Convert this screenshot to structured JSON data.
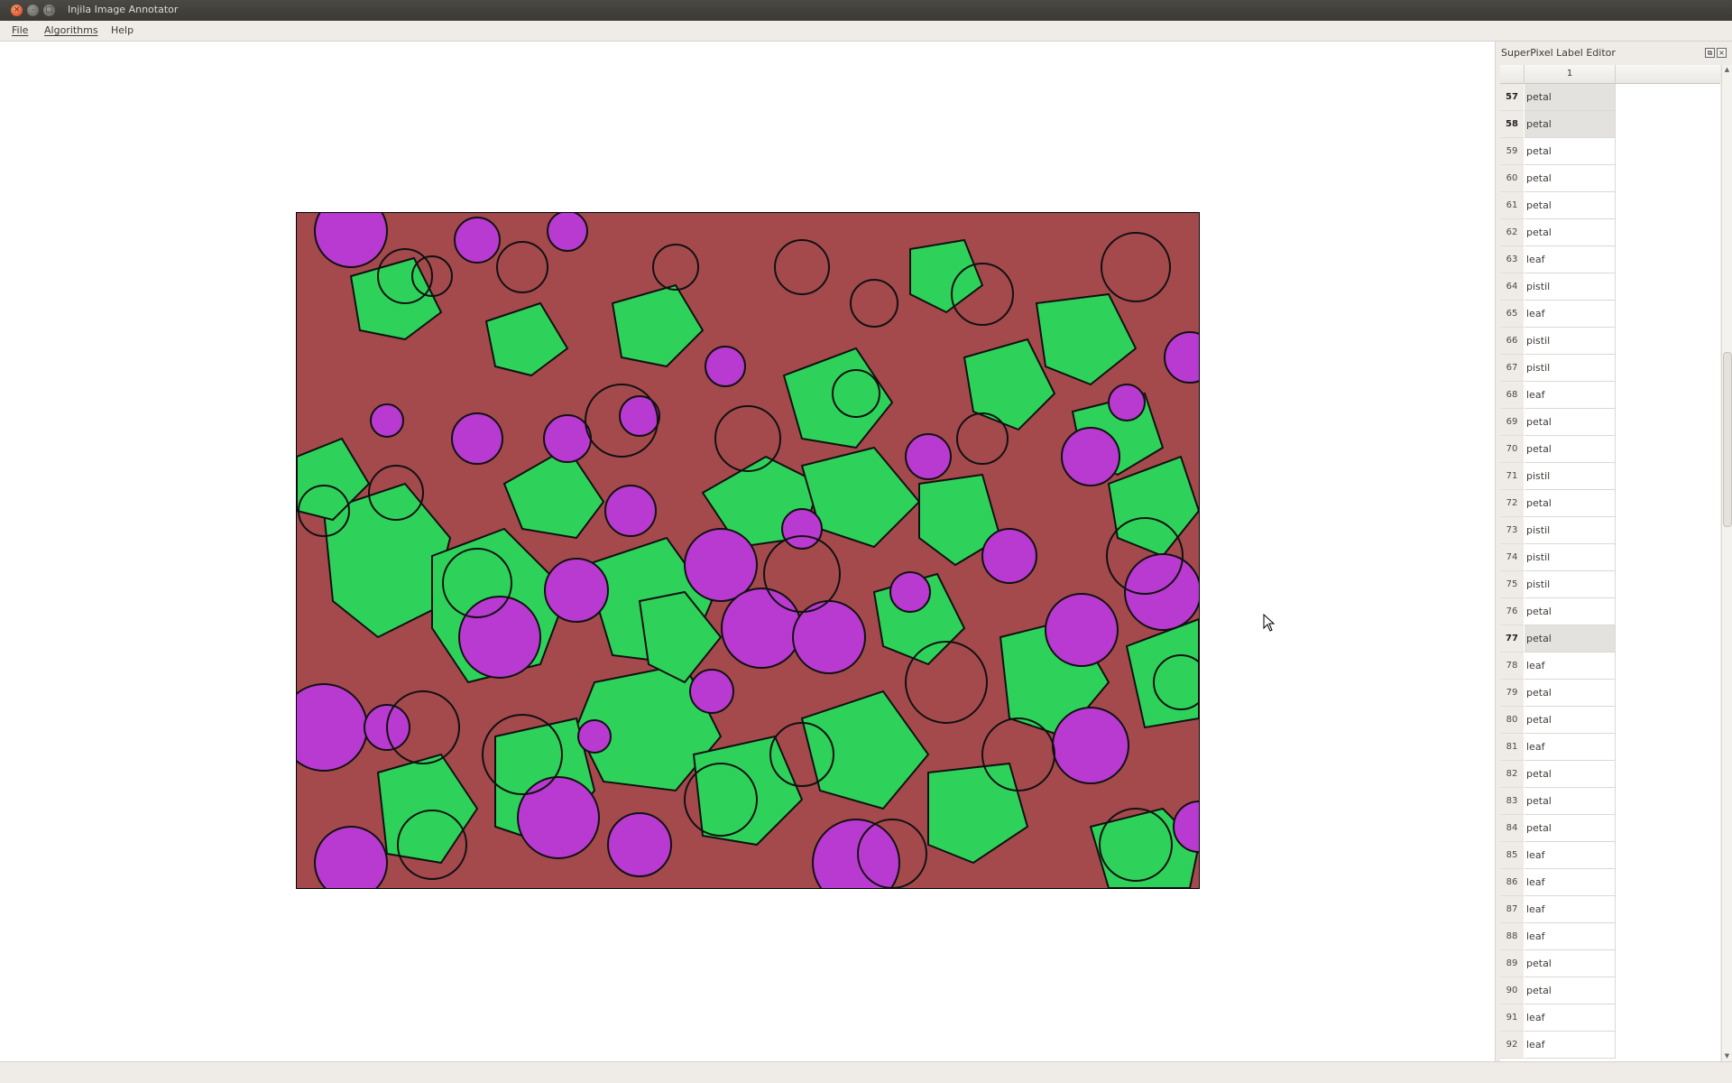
{
  "window": {
    "title": "Injila Image Annotator",
    "close_glyph": "×",
    "min_glyph": "–",
    "max_glyph": "□"
  },
  "menu": [
    "File",
    "Algorithms",
    "Help"
  ],
  "dock": {
    "title": "SuperPixel Label Editor",
    "column_header": "1",
    "float_glyph": "⧉",
    "close_glyph": "×",
    "rows": [
      {
        "num": "57",
        "label": "petal",
        "selected": true
      },
      {
        "num": "58",
        "label": "petal",
        "selected": true
      },
      {
        "num": "59",
        "label": "petal"
      },
      {
        "num": "60",
        "label": "petal"
      },
      {
        "num": "61",
        "label": "petal"
      },
      {
        "num": "62",
        "label": "petal"
      },
      {
        "num": "63",
        "label": "leaf"
      },
      {
        "num": "64",
        "label": "pistil"
      },
      {
        "num": "65",
        "label": "leaf"
      },
      {
        "num": "66",
        "label": "pistil"
      },
      {
        "num": "67",
        "label": "pistil"
      },
      {
        "num": "68",
        "label": "leaf"
      },
      {
        "num": "69",
        "label": "petal"
      },
      {
        "num": "70",
        "label": "petal"
      },
      {
        "num": "71",
        "label": "pistil"
      },
      {
        "num": "72",
        "label": "petal"
      },
      {
        "num": "73",
        "label": "pistil"
      },
      {
        "num": "74",
        "label": "pistil"
      },
      {
        "num": "75",
        "label": "pistil"
      },
      {
        "num": "76",
        "label": "petal"
      },
      {
        "num": "77",
        "label": "petal",
        "selected": true
      },
      {
        "num": "78",
        "label": "leaf"
      },
      {
        "num": "79",
        "label": "petal"
      },
      {
        "num": "80",
        "label": "petal"
      },
      {
        "num": "81",
        "label": "leaf"
      },
      {
        "num": "82",
        "label": "petal"
      },
      {
        "num": "83",
        "label": "petal"
      },
      {
        "num": "84",
        "label": "petal"
      },
      {
        "num": "85",
        "label": "leaf"
      },
      {
        "num": "86",
        "label": "leaf"
      },
      {
        "num": "87",
        "label": "leaf"
      },
      {
        "num": "88",
        "label": "leaf"
      },
      {
        "num": "89",
        "label": "petal"
      },
      {
        "num": "90",
        "label": "petal"
      },
      {
        "num": "91",
        "label": "leaf"
      },
      {
        "num": "92",
        "label": "leaf"
      }
    ]
  },
  "scrollbar": {
    "up_glyph": "▲",
    "down_glyph": "▼"
  },
  "colors": {
    "petal": "#a44a4d",
    "leaf": "#2ed25a",
    "pistil": "#b83ad0",
    "outline": "#111111"
  },
  "icons": {
    "close": "close-icon",
    "minimize": "minimize-icon",
    "maximize": "maximize-icon",
    "float": "float-icon",
    "cursor": "mouse-pointer-icon"
  }
}
